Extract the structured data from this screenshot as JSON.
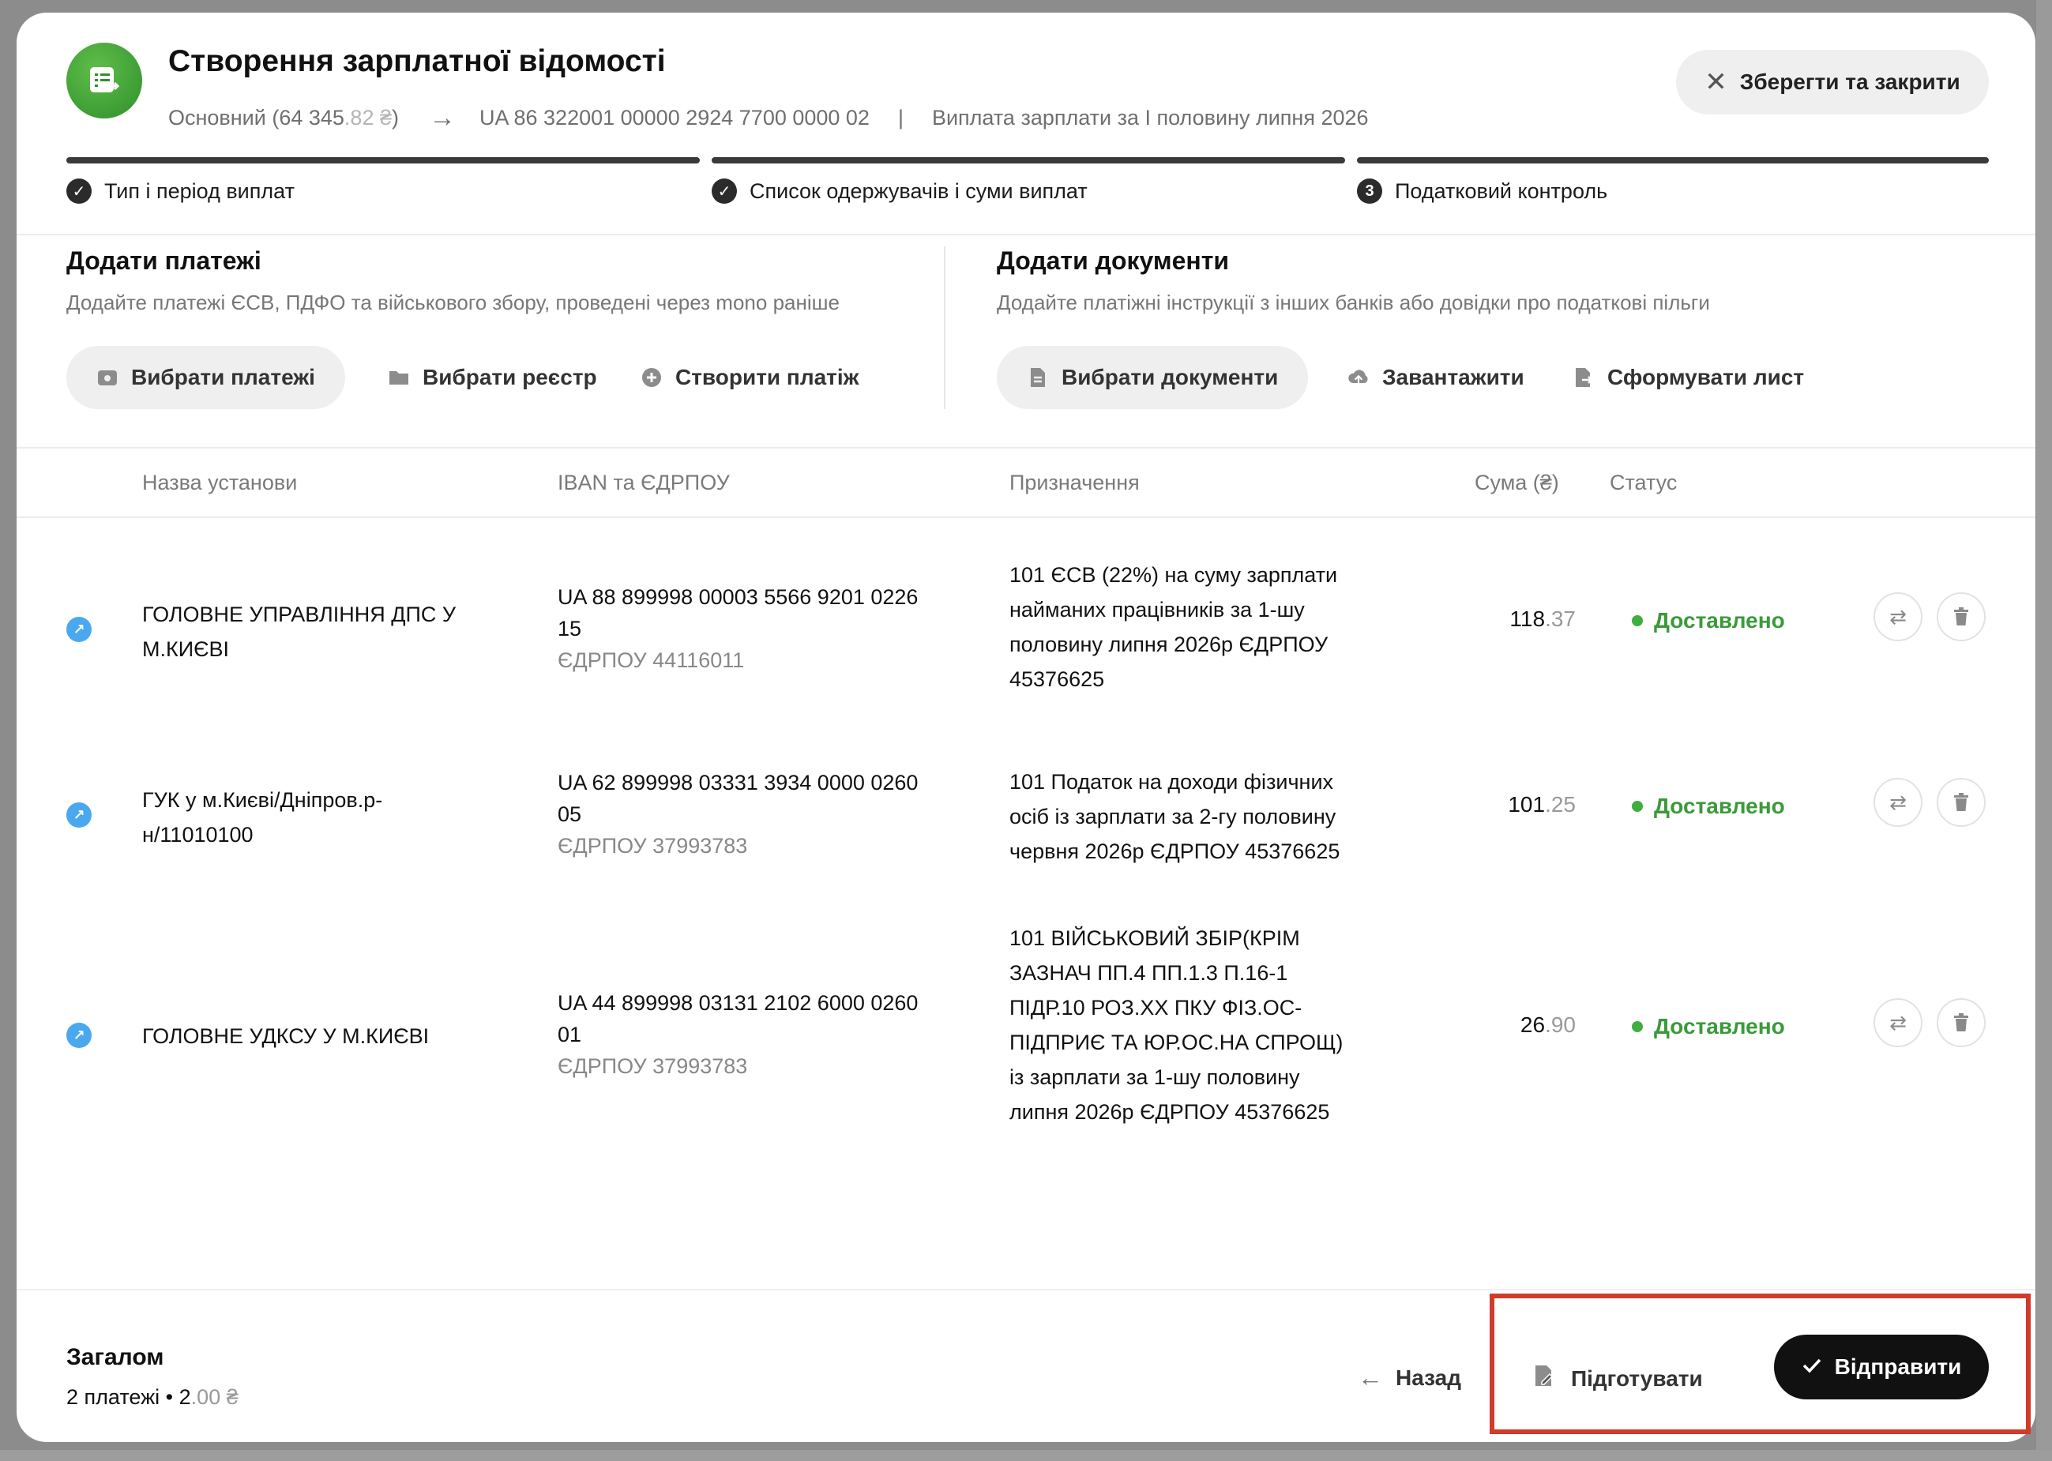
{
  "header": {
    "title": "Створення зарплатної відомості",
    "account": "Основний (64 345",
    "account_cents": ".82 ₴",
    "account_close": ")",
    "iban": "UA 86 322001 00000 2924 7700 0000 02",
    "separator": "|",
    "payment_desc": "Виплата зарплати за I половину липня 2026",
    "save_close_label": "Зберегти та закрити"
  },
  "steps": [
    {
      "label": "Тип і період виплат",
      "marker": "✓"
    },
    {
      "label": "Список одержувачів і суми виплат",
      "marker": "✓"
    },
    {
      "label": "Податковий контроль",
      "marker": "3"
    }
  ],
  "add_payments": {
    "title": "Додати платежі",
    "description": "Додайте платежі ЄСВ, ПДФО та військового збору, проведені через mono раніше",
    "actions": [
      "Вибрати платежі",
      "Вибрати реєстр",
      "Створити платіж"
    ]
  },
  "add_documents": {
    "title": "Додати документи",
    "description": "Додайте платіжні інструкції з інших банків або довідки про податкові пільги",
    "actions": [
      "Вибрати документи",
      "Завантажити",
      "Сформувати лист"
    ]
  },
  "table": {
    "headers": [
      "Назва установи",
      "IBAN та ЄДРПОУ",
      "Призначення",
      "Сума (₴)",
      "Статус"
    ],
    "rows": [
      {
        "name_lines": [
          "ГОЛОВНЕ УПРАВЛІННЯ ДПС У",
          "М.КИЄВІ"
        ],
        "iban_lines": [
          "UA 88 899998 00003 5566 9201 0226",
          "15"
        ],
        "edrpou": "ЄДРПОУ 44116011",
        "purpose_lines": [
          "101 ЄСВ (22%) на суму зарплати",
          "найманих працівників за 1-шу",
          "половину липня 2026р ЄДРПОУ",
          "45376625"
        ],
        "amount_int": "118",
        "amount_cents": ".37",
        "status": "Доставлено"
      },
      {
        "name_lines": [
          "ГУК у м.Києві/Дніпров.р-",
          "н/11010100"
        ],
        "iban_lines": [
          "UA 62 899998 03331 3934 0000 0260",
          "05"
        ],
        "edrpou": "ЄДРПОУ 37993783",
        "purpose_lines": [
          "101 Податок на доходи фізичних",
          "осіб із зарплати за 2-гу половину",
          "червня 2026р ЄДРПОУ 45376625"
        ],
        "amount_int": "101",
        "amount_cents": ".25",
        "status": "Доставлено"
      },
      {
        "name_lines": [
          "ГОЛОВНЕ УДКСУ У М.КИЄВІ"
        ],
        "iban_lines": [
          "UA 44 899998 03131 2102 6000 0260",
          "01"
        ],
        "edrpou": "ЄДРПОУ 37993783",
        "purpose_lines": [
          "101 ВІЙСЬКОВИЙ ЗБІР(КРІМ",
          "ЗАЗНАЧ ПП.4 ПП.1.3 П.16-1",
          "ПІДР.10 РОЗ.ХХ ПКУ ФІЗ.ОС-",
          "ПІДПРИЄ ТА ЮР.ОС.НА СПРОЩ)",
          "із зарплати за 1-шу половину",
          "липня 2026р ЄДРПОУ 45376625"
        ],
        "amount_int": "26",
        "amount_cents": ".90",
        "status": "Доставлено"
      }
    ]
  },
  "footer": {
    "total_title": "Загалом",
    "total_count": "2 платежі",
    "bullet": "•",
    "total_int": "2",
    "total_cents": ".00 ₴",
    "back_label": "Назад",
    "prepare_label": "Підготувати",
    "send_label": "Відправити"
  },
  "colors": {
    "accent_green": "#3fae3f",
    "link_blue": "#4aa8ef",
    "highlight_red": "#d23a2a",
    "primary_button": "#111111"
  }
}
